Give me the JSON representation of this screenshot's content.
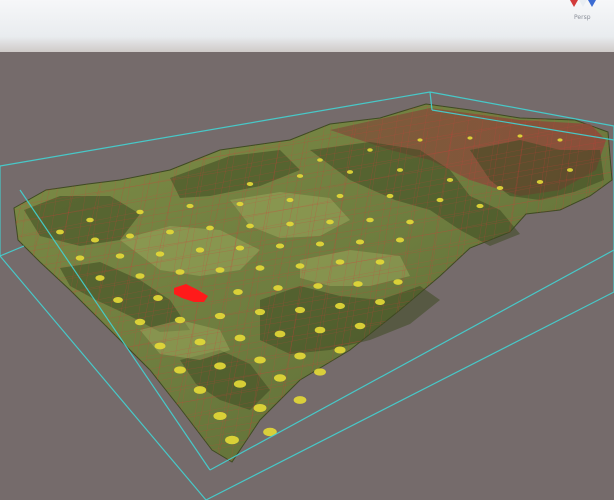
{
  "scene": {
    "sky_top": "#f3f5f7",
    "sky_bottom": "#e7ebee",
    "horizon": "#c9c4c2",
    "ground": "#756b6b",
    "terrain_base": "#6e7d3f",
    "terrain_highlight": "#9aa859",
    "terrain_dark": "#3e4a22",
    "terrain_red_zone": "#8a4c3a",
    "bounds_color": "#43d3d3",
    "grid_color": "#d83a3a",
    "marker_color": "#e3d837",
    "agent_color": "#ff1a1a"
  },
  "gizmo": {
    "icon": "axis-gizmo-icon",
    "label": "Persp"
  }
}
